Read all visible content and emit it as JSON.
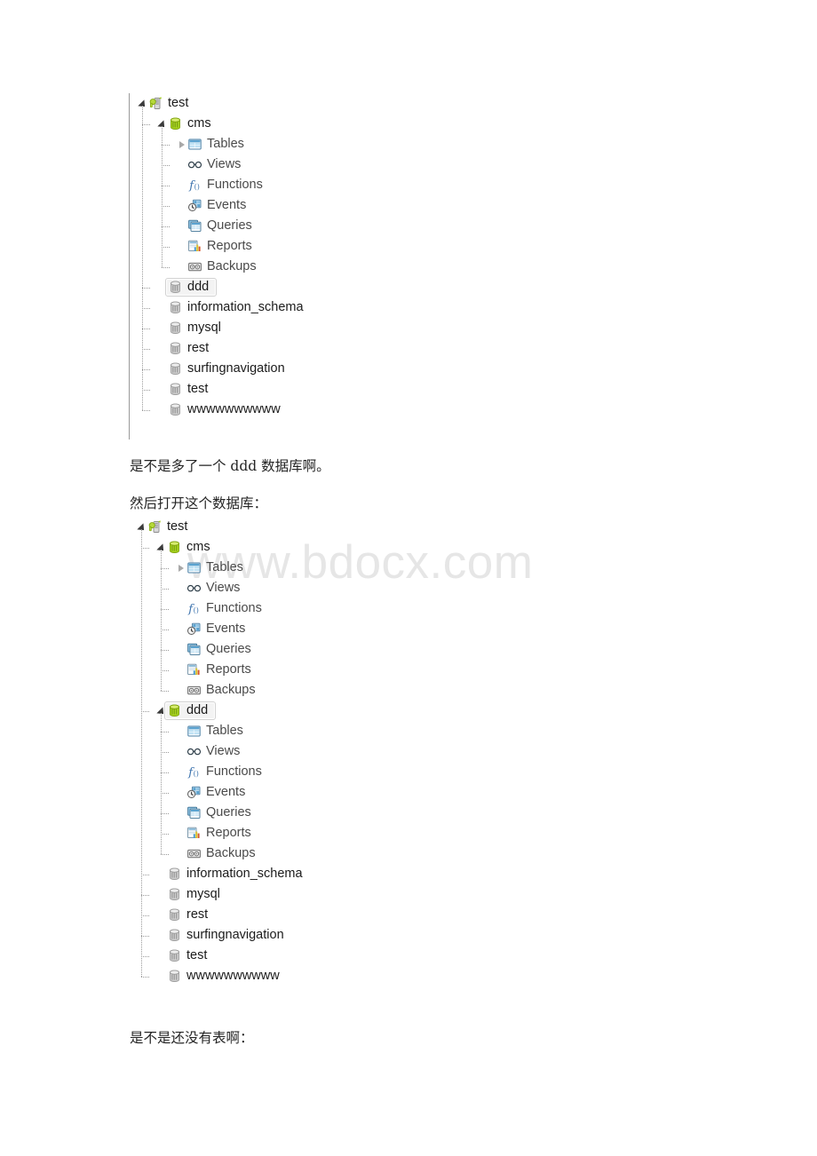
{
  "watermark": {
    "text": "www.bdocx.com",
    "color": "#e6e6e6"
  },
  "paragraphs": [
    {
      "id": "p1",
      "text": "是不是多了一个 ddd 数据库啊。"
    },
    {
      "id": "p2",
      "text": "然后打开这个数据库："
    },
    {
      "id": "p3",
      "text": "是不是还没有表啊："
    }
  ],
  "tree_one": {
    "name": "navicat-connection-tree-collapsed",
    "nodes": [
      {
        "label": "test",
        "icon": "connection-icon",
        "depth": 0,
        "expander": "open",
        "selected": false
      },
      {
        "label": "cms",
        "icon": "database-active-icon",
        "depth": 1,
        "expander": "open",
        "selected": false
      },
      {
        "label": "Tables",
        "icon": "tables-icon",
        "depth": 2,
        "expander": "closed",
        "selected": false
      },
      {
        "label": "Views",
        "icon": "views-icon",
        "depth": 2,
        "expander": "none",
        "selected": false
      },
      {
        "label": "Functions",
        "icon": "functions-icon",
        "depth": 2,
        "expander": "none",
        "selected": false
      },
      {
        "label": "Events",
        "icon": "events-icon",
        "depth": 2,
        "expander": "none",
        "selected": false
      },
      {
        "label": "Queries",
        "icon": "queries-icon",
        "depth": 2,
        "expander": "none",
        "selected": false
      },
      {
        "label": "Reports",
        "icon": "reports-icon",
        "depth": 2,
        "expander": "none",
        "selected": false
      },
      {
        "label": "Backups",
        "icon": "backups-icon",
        "depth": 2,
        "expander": "none",
        "selected": false
      },
      {
        "label": "ddd",
        "icon": "database-idle-icon",
        "depth": 1,
        "expander": "none",
        "selected": true
      },
      {
        "label": "information_schema",
        "icon": "database-idle-icon",
        "depth": 1,
        "expander": "none",
        "selected": false
      },
      {
        "label": "mysql",
        "icon": "database-idle-icon",
        "depth": 1,
        "expander": "none",
        "selected": false
      },
      {
        "label": "rest",
        "icon": "database-idle-icon",
        "depth": 1,
        "expander": "none",
        "selected": false
      },
      {
        "label": "surfingnavigation",
        "icon": "database-idle-icon",
        "depth": 1,
        "expander": "none",
        "selected": false
      },
      {
        "label": "test",
        "icon": "database-idle-icon",
        "depth": 1,
        "expander": "none",
        "selected": false
      },
      {
        "label": "wwwwwwwwww",
        "icon": "database-idle-icon",
        "depth": 1,
        "expander": "none",
        "selected": false
      }
    ]
  },
  "tree_two": {
    "name": "navicat-connection-tree-expanded",
    "nodes": [
      {
        "label": "test",
        "icon": "connection-icon",
        "depth": 0,
        "expander": "open",
        "selected": false
      },
      {
        "label": "cms",
        "icon": "database-active-icon",
        "depth": 1,
        "expander": "open",
        "selected": false
      },
      {
        "label": "Tables",
        "icon": "tables-icon",
        "depth": 2,
        "expander": "closed",
        "selected": false
      },
      {
        "label": "Views",
        "icon": "views-icon",
        "depth": 2,
        "expander": "none",
        "selected": false
      },
      {
        "label": "Functions",
        "icon": "functions-icon",
        "depth": 2,
        "expander": "none",
        "selected": false
      },
      {
        "label": "Events",
        "icon": "events-icon",
        "depth": 2,
        "expander": "none",
        "selected": false
      },
      {
        "label": "Queries",
        "icon": "queries-icon",
        "depth": 2,
        "expander": "none",
        "selected": false
      },
      {
        "label": "Reports",
        "icon": "reports-icon",
        "depth": 2,
        "expander": "none",
        "selected": false
      },
      {
        "label": "Backups",
        "icon": "backups-icon",
        "depth": 2,
        "expander": "none",
        "selected": false
      },
      {
        "label": "ddd",
        "icon": "database-active-icon",
        "depth": 1,
        "expander": "open",
        "selected": true
      },
      {
        "label": "Tables",
        "icon": "tables-icon",
        "depth": 2,
        "expander": "none",
        "selected": false
      },
      {
        "label": "Views",
        "icon": "views-icon",
        "depth": 2,
        "expander": "none",
        "selected": false
      },
      {
        "label": "Functions",
        "icon": "functions-icon",
        "depth": 2,
        "expander": "none",
        "selected": false
      },
      {
        "label": "Events",
        "icon": "events-icon",
        "depth": 2,
        "expander": "none",
        "selected": false
      },
      {
        "label": "Queries",
        "icon": "queries-icon",
        "depth": 2,
        "expander": "none",
        "selected": false
      },
      {
        "label": "Reports",
        "icon": "reports-icon",
        "depth": 2,
        "expander": "none",
        "selected": false
      },
      {
        "label": "Backups",
        "icon": "backups-icon",
        "depth": 2,
        "expander": "none",
        "selected": false
      },
      {
        "label": "information_schema",
        "icon": "database-idle-icon",
        "depth": 1,
        "expander": "none",
        "selected": false
      },
      {
        "label": "mysql",
        "icon": "database-idle-icon",
        "depth": 1,
        "expander": "none",
        "selected": false
      },
      {
        "label": "rest",
        "icon": "database-idle-icon",
        "depth": 1,
        "expander": "none",
        "selected": false
      },
      {
        "label": "surfingnavigation",
        "icon": "database-idle-icon",
        "depth": 1,
        "expander": "none",
        "selected": false
      },
      {
        "label": "test",
        "icon": "database-idle-icon",
        "depth": 1,
        "expander": "none",
        "selected": false
      },
      {
        "label": "wwwwwwwwww",
        "icon": "database-idle-icon",
        "depth": 1,
        "expander": "none",
        "selected": false
      }
    ]
  }
}
